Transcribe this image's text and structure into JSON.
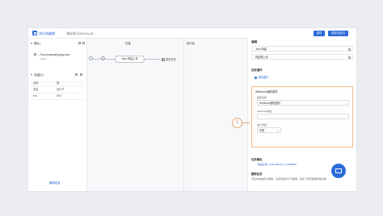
{
  "titlebar": {
    "title": "流水线编辑",
    "subtitle": "流水线 2020-04-28",
    "save_label": "保存",
    "save_run_label": "保存并运行"
  },
  "left": {
    "source_header": "源(1)",
    "repo_name": "...Flow-example/spring-boot",
    "repo_branch": "master",
    "vars_header": "变量(3)",
    "vars_table": {
      "col_name": "名称",
      "col_value": "值",
      "rows": [
        {
          "name": "变量",
          "value": "运行于"
        },
        {
          "name": "env",
          "value": "DEV"
        }
      ]
    },
    "edit_vars": "编辑变量"
  },
  "canvas": {
    "stage1_label": "构建",
    "stage2_label": "新阶段",
    "node_index": "0",
    "job_label": "Java 构建上传",
    "add_task_label": "新的任务"
  },
  "right": {
    "title": "编辑",
    "steps": [
      {
        "label": "Java 构建"
      },
      {
        "label": "构建物上传"
      }
    ],
    "task_plugin_header": "任务插件",
    "add_plugin": "添加插件",
    "webhook": {
      "header": "Webhook通知插件",
      "name_label": "插件名称",
      "name_value": "Webhook通知插件",
      "url_label": "Webhook地址",
      "run_condition_label": "运行时机",
      "run_condition_value": "失败"
    },
    "output_header": "任务输出",
    "output_value": "制品名称: default(BUILD_NUMBER)",
    "delete_header": "删除任务",
    "delete_desc": "该任务将被永久删除，注意该操作不可撤销，任务下所有数据将被清除"
  },
  "annotation": {
    "number": "1"
  },
  "colors": {
    "accent": "#2d6bd9",
    "highlight_border": "#f2b98a"
  }
}
